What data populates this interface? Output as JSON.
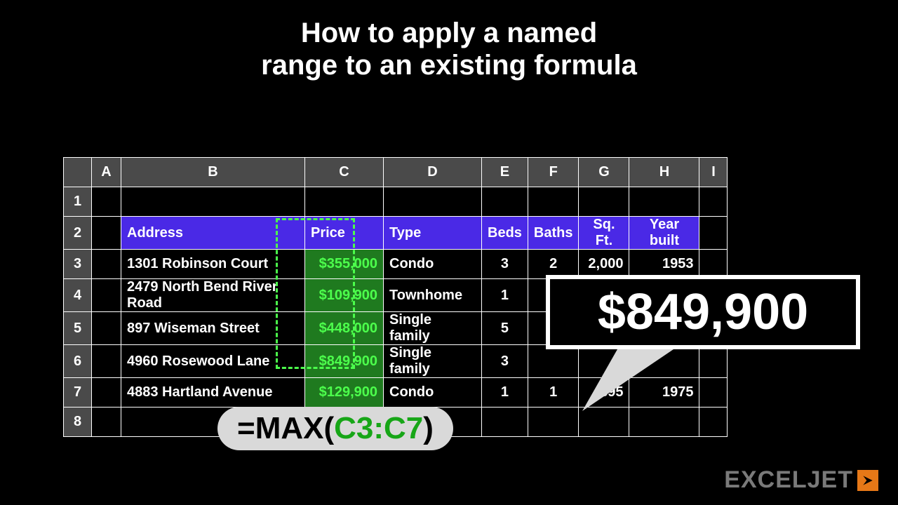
{
  "title_line1": "How to apply a named",
  "title_line2": "range to an existing formula",
  "columns": [
    "A",
    "B",
    "C",
    "D",
    "E",
    "F",
    "G",
    "H",
    "I"
  ],
  "row_numbers": [
    "1",
    "2",
    "3",
    "4",
    "5",
    "6",
    "7",
    "8"
  ],
  "headers": {
    "address": "Address",
    "price": "Price",
    "type": "Type",
    "beds": "Beds",
    "baths": "Baths",
    "sqft": "Sq. Ft.",
    "year": "Year built"
  },
  "rows": [
    {
      "address": "1301 Robinson Court",
      "price": "$355,000",
      "type": "Condo",
      "beds": "3",
      "baths": "2",
      "sqft": "2,000",
      "year": "1953"
    },
    {
      "address": "2479 North Bend River Road",
      "price": "$109,900",
      "type": "Townhome",
      "beds": "1",
      "baths": "",
      "sqft": "",
      "year": ""
    },
    {
      "address": "897 Wiseman Street",
      "price": "$448,000",
      "type": "Single family",
      "beds": "5",
      "baths": "",
      "sqft": "",
      "year": ""
    },
    {
      "address": "4960 Rosewood Lane",
      "price": "$849,900",
      "type": "Single family",
      "beds": "3",
      "baths": "",
      "sqft": "",
      "year": ""
    },
    {
      "address": "4883 Hartland Avenue",
      "price": "$129,900",
      "type": "Condo",
      "beds": "1",
      "baths": "1",
      "sqft": "895",
      "year": "1975"
    }
  ],
  "result": "$849,900",
  "formula_prefix": "=MAX(",
  "formula_range": "C3:C7",
  "formula_suffix": ")",
  "brand": "EXCELJET",
  "chart_data": {
    "type": "table",
    "title": "How to apply a named range to an existing formula",
    "columns": [
      "Address",
      "Price",
      "Type",
      "Beds",
      "Baths",
      "Sq. Ft.",
      "Year built"
    ],
    "rows": [
      [
        "1301 Robinson Court",
        355000,
        "Condo",
        3,
        2,
        2000,
        1953
      ],
      [
        "2479 North Bend River Road",
        109900,
        "Townhome",
        1,
        null,
        null,
        null
      ],
      [
        "897 Wiseman Street",
        448000,
        "Single family",
        5,
        null,
        null,
        null
      ],
      [
        "4960 Rosewood Lane",
        849900,
        "Single family",
        3,
        null,
        null,
        null
      ],
      [
        "4883 Hartland Avenue",
        129900,
        "Condo",
        1,
        1,
        895,
        1975
      ]
    ],
    "formula": "=MAX(C3:C7)",
    "formula_result": 849900
  }
}
